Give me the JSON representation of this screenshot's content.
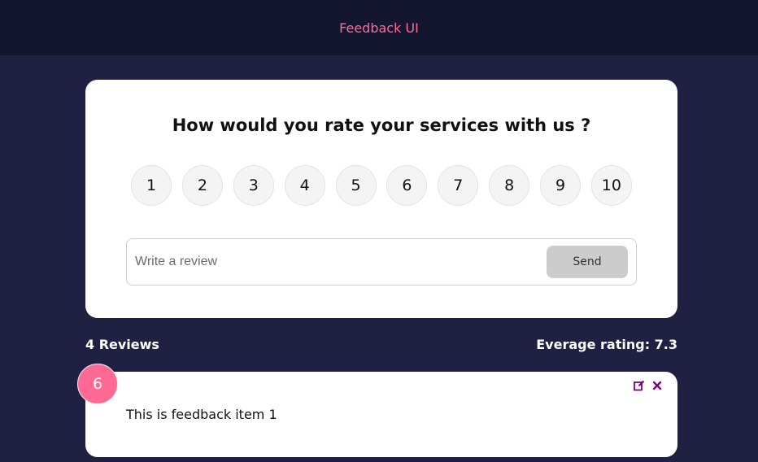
{
  "header": {
    "title": "Feedback UI"
  },
  "rating_form": {
    "question": "How would you rate your services with us ?",
    "options": [
      "1",
      "2",
      "3",
      "4",
      "5",
      "6",
      "7",
      "8",
      "9",
      "10"
    ],
    "input_placeholder": "Write a review",
    "input_value": "",
    "send_label": "Send"
  },
  "stats": {
    "review_count": "4 Reviews",
    "average": "Everage rating: 7.3"
  },
  "feedback_items": [
    {
      "rating": "6",
      "text": "This is feedback item 1"
    }
  ],
  "colors": {
    "background": "#202142",
    "header_bg": "#141630",
    "accent": "#ff6a95",
    "icon": "#800080",
    "send_button": "#cccccc"
  },
  "icons": {
    "edit": "edit-icon",
    "delete": "close-icon"
  }
}
